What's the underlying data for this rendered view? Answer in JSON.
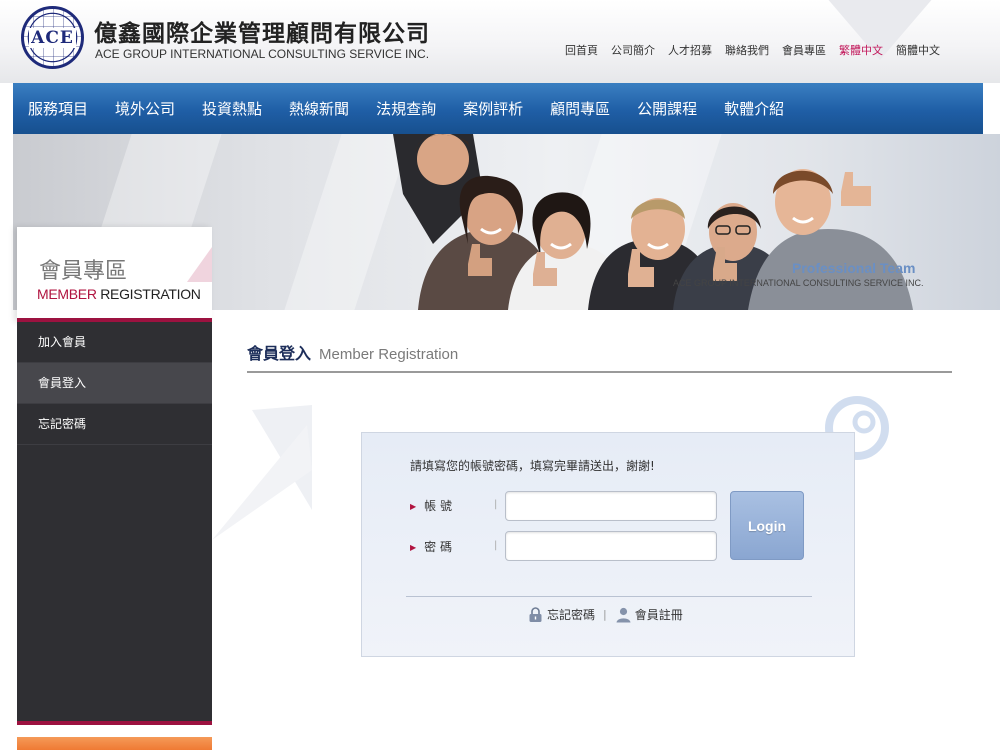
{
  "brand": {
    "logo_text": "ACE",
    "name_zh": "億鑫國際企業管理顧問有限公司",
    "name_en": "ACE GROUP INTERNATIONAL CONSULTING SERVICE INC."
  },
  "top_links": [
    {
      "label": "回首頁",
      "active": false
    },
    {
      "label": "公司簡介",
      "active": false
    },
    {
      "label": "人才招募",
      "active": false
    },
    {
      "label": "聯絡我們",
      "active": false
    },
    {
      "label": "會員專區",
      "active": false
    },
    {
      "label": "繁體中文",
      "active": true
    },
    {
      "label": "簡體中文",
      "active": false
    }
  ],
  "nav": [
    "服務項目",
    "境外公司",
    "投資熱點",
    "熱線新聞",
    "法規查詢",
    "案例評析",
    "顧問專區",
    "公開課程",
    "軟體介紹"
  ],
  "banner": {
    "title": "Professional  Team",
    "subtitle": "ACE GROUP INTERNATIONAL CONSULTING SERVICE INC."
  },
  "sidebar": {
    "title_zh": "會員專區",
    "title_en_highlight": "MEMBER",
    "title_en_rest": " REGISTRATION",
    "items": [
      {
        "label": "加入會員",
        "active": false
      },
      {
        "label": "會員登入",
        "active": true
      },
      {
        "label": "忘記密碼",
        "active": false
      }
    ]
  },
  "main": {
    "heading_zh": "會員登入",
    "heading_en": "Member Registration"
  },
  "login": {
    "instruction": "請填寫您的帳號密碼，填寫完畢請送出，謝謝!",
    "account_label": "帳 號",
    "password_label": "密 碼",
    "account_value": "",
    "password_value": "",
    "submit_label": "Login",
    "forgot_label": "忘記密碼",
    "register_label": "會員註冊",
    "divider": "|"
  },
  "colors": {
    "nav_blue": "#1f5ea6",
    "brand_red": "#9c1240",
    "active_lang": "#c2185b",
    "sidebar_dark": "#2f2f33",
    "button_blue": "#8aa6d1"
  }
}
